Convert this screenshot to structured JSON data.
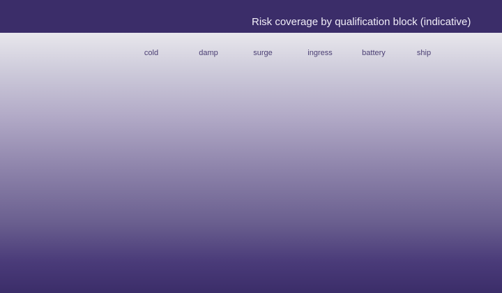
{
  "header": {
    "title": "Risk coverage by qualification block (indicative)"
  },
  "columns": [
    "cold",
    "damp",
    "surge",
    "ingress",
    "battery",
    "ship"
  ]
}
